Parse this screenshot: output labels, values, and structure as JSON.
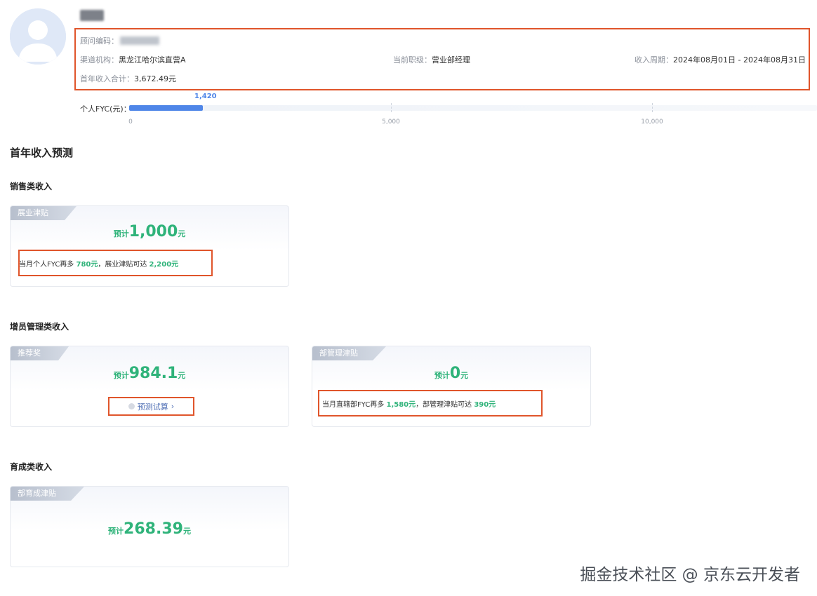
{
  "profile": {
    "avatar_icon": "user-avatar-icon",
    "consultant_code_label": "顾问编码：",
    "channel_label": "渠道机构：",
    "channel_value": "黑龙江哈尔滨直营A",
    "rank_label": "当前职级：",
    "rank_value": "营业部经理",
    "period_label": "收入周期：",
    "period_value": "2024年08月01日 - 2024年08月31日",
    "first_year_income_label": "首年收入合计：",
    "first_year_income_value": "3,672.49元"
  },
  "fyc": {
    "label": "个人FYC(元)：",
    "value_label": "1,420",
    "value": 1420,
    "max": 13215,
    "ticks": [
      "0",
      "5,000",
      "10,000"
    ],
    "bar_color": "#4f86e8"
  },
  "page_title": "首年收入预测",
  "sections": {
    "sales": {
      "title": "销售类收入",
      "card": {
        "tag": "展业津贴",
        "prefix": "预计",
        "amount": "1,000",
        "unit": "元",
        "hint_1": "当月个人FYC再多 ",
        "hint_val_1": "780元",
        "hint_2": "，展业津贴可达 ",
        "hint_val_2": "2,200元"
      }
    },
    "management": {
      "title": "增员管理类收入",
      "referral_card": {
        "tag": "推荐奖",
        "prefix": "预计",
        "amount": "984.1",
        "unit": "元",
        "calc_button": "预测试算",
        "calc_arrow": "›"
      },
      "dept_card": {
        "tag": "部管理津贴",
        "prefix": "预计",
        "amount": "0",
        "unit": "元",
        "hint_1": "当月直辖部FYC再多 ",
        "hint_val_1": "1,580元",
        "hint_2": "，部管理津贴可达 ",
        "hint_val_2": "390元"
      }
    },
    "cultivation": {
      "title": "育成类收入",
      "card": {
        "tag": "部育成津贴",
        "prefix": "预计",
        "amount": "268.39",
        "unit": "元"
      }
    }
  },
  "watermark": "掘金技术社区 @ 京东云开发者",
  "colors": {
    "accent_green": "#2fb37a",
    "highlight_red": "#e0552b",
    "link_blue": "#4f6fb5"
  }
}
